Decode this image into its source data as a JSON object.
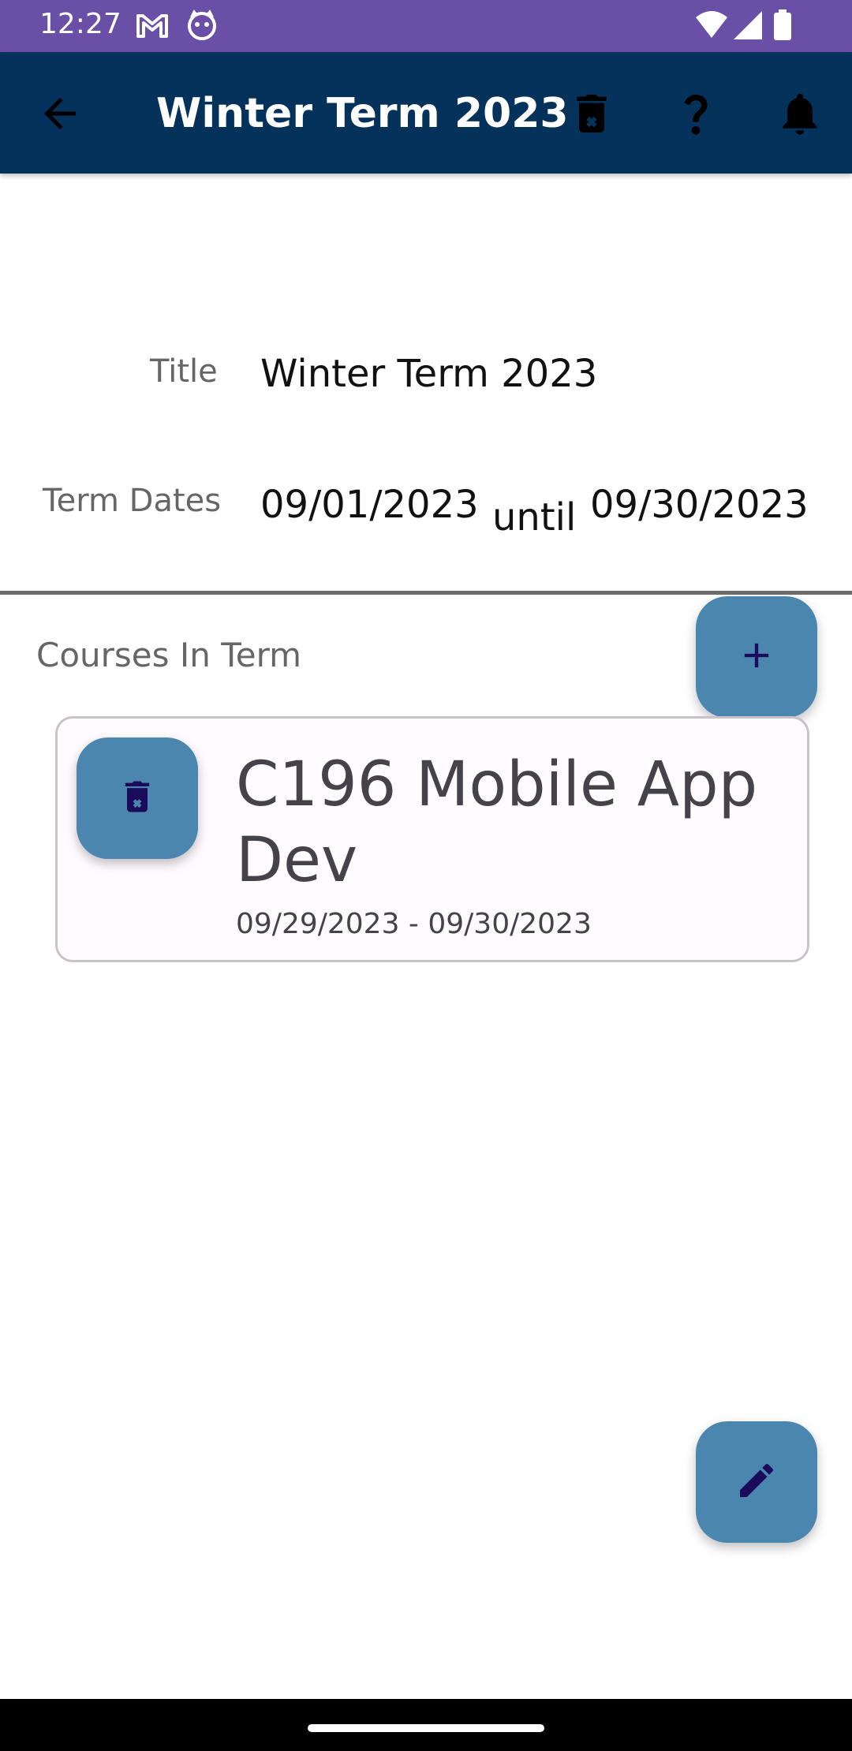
{
  "status_bar": {
    "time": "12:27",
    "icons": [
      "gmail-icon",
      "cat-face-icon",
      "wifi-icon",
      "signal-icon",
      "battery-icon"
    ]
  },
  "app_bar": {
    "title": "Winter Term 2023",
    "actions": [
      "delete-term-icon",
      "help-icon",
      "notifications-icon"
    ],
    "background": "#04325a"
  },
  "form": {
    "title_label": "Title",
    "title_value": "Winter Term 2023",
    "dates_label": "Term Dates",
    "start_date": "09/01/2023",
    "until_label": "until",
    "end_date": "09/30/2023"
  },
  "courses": {
    "section_label": "Courses In Term",
    "items": [
      {
        "title": "C196 Mobile App Dev",
        "dates": "09/29/2023 - 09/30/2023"
      }
    ]
  },
  "colors": {
    "status_bar": "#6a4fa6",
    "fab": "#4a86ae",
    "fab_icon": "#1c0b5a"
  }
}
